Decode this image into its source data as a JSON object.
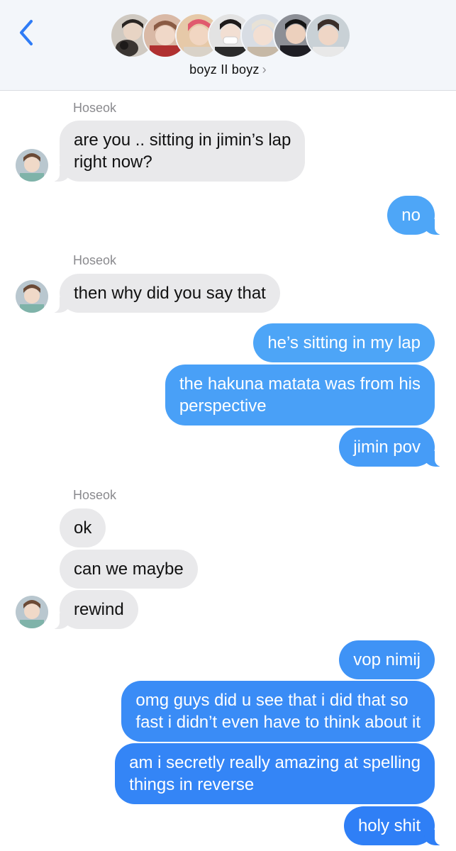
{
  "header": {
    "group_name": "boyz II boyz",
    "chevron": "›",
    "back_icon": "chevron-left-icon",
    "accent_color": "#2f7cf6"
  },
  "messages": [
    {
      "sender": "Hoseok"
    },
    {
      "text_lines": [
        "are you .. sitting in jimin’s lap",
        "right now?"
      ],
      "from": "Hoseok"
    },
    {
      "text": "no",
      "from": "me"
    },
    {
      "sender": "Hoseok"
    },
    {
      "text": "then why did you say that",
      "from": "Hoseok"
    },
    {
      "text": "he’s sitting in my lap",
      "from": "me"
    },
    {
      "text_lines": [
        "the hakuna matata was from his",
        "perspective"
      ],
      "from": "me"
    },
    {
      "text": "jimin pov",
      "from": "me"
    },
    {
      "sender": "Hoseok"
    },
    {
      "text": "ok",
      "from": "Hoseok"
    },
    {
      "text": "can we maybe",
      "from": "Hoseok"
    },
    {
      "text": "rewind",
      "from": "Hoseok"
    },
    {
      "text": "vop nimij",
      "from": "me"
    },
    {
      "text_lines": [
        "omg guys did u see that i did that so",
        "fast i didn’t even have to think about it"
      ],
      "from": "me"
    },
    {
      "text_lines": [
        "am i secretly really amazing at spelling",
        "things in reverse"
      ],
      "from": "me"
    },
    {
      "text": "holy shit",
      "from": "me"
    }
  ],
  "colors": {
    "incoming_bubble": "#e9e9eb",
    "outgoing_gradient_top": "#4aa3f7",
    "outgoing_gradient_bottom": "#2f7cf6"
  }
}
